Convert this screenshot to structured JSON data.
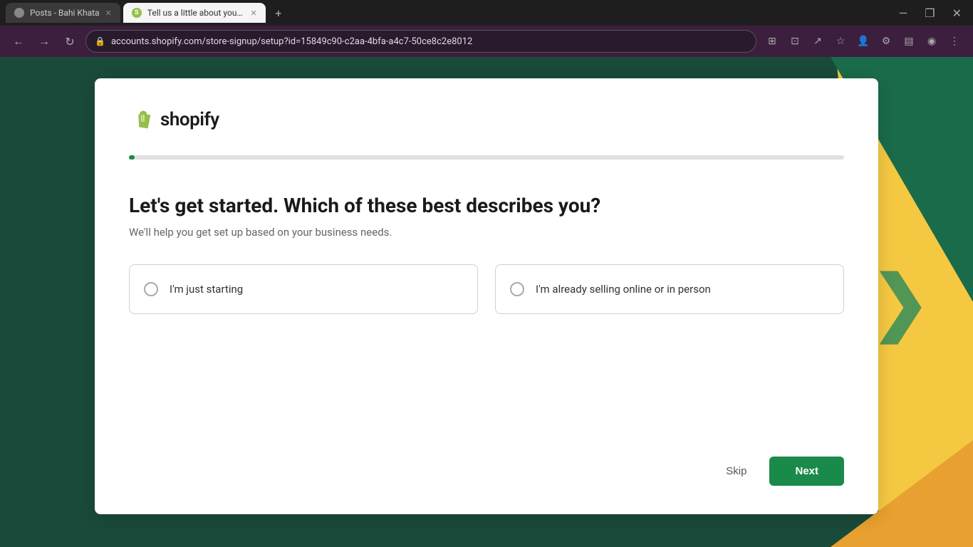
{
  "browser": {
    "tabs": [
      {
        "id": "tab1",
        "label": "Posts - Bahi Khata",
        "favicon_type": "circle",
        "active": false,
        "closeable": true
      },
      {
        "id": "tab2",
        "label": "Tell us a little about yourself — S",
        "favicon_type": "shopify",
        "active": true,
        "closeable": true
      }
    ],
    "new_tab_icon": "+",
    "window_controls": [
      "—",
      "❐",
      "✕"
    ],
    "address_bar_url": "accounts.shopify.com/store-signup/setup?id=15849c90-c2aa-4bfa-a4c7-50ce8c2e8012",
    "lock_icon": "🔒"
  },
  "page": {
    "logo": {
      "wordmark": "shopify"
    },
    "progress": {
      "fill_percent": 2
    },
    "question": {
      "title": "Let's get started. Which of these best describes you?",
      "subtitle": "We'll help you get set up based on your business needs."
    },
    "options": [
      {
        "id": "option1",
        "label": "I'm just starting"
      },
      {
        "id": "option2",
        "label": "I'm already selling online or in person"
      }
    ],
    "actions": {
      "skip_label": "Skip",
      "next_label": "Next"
    }
  }
}
